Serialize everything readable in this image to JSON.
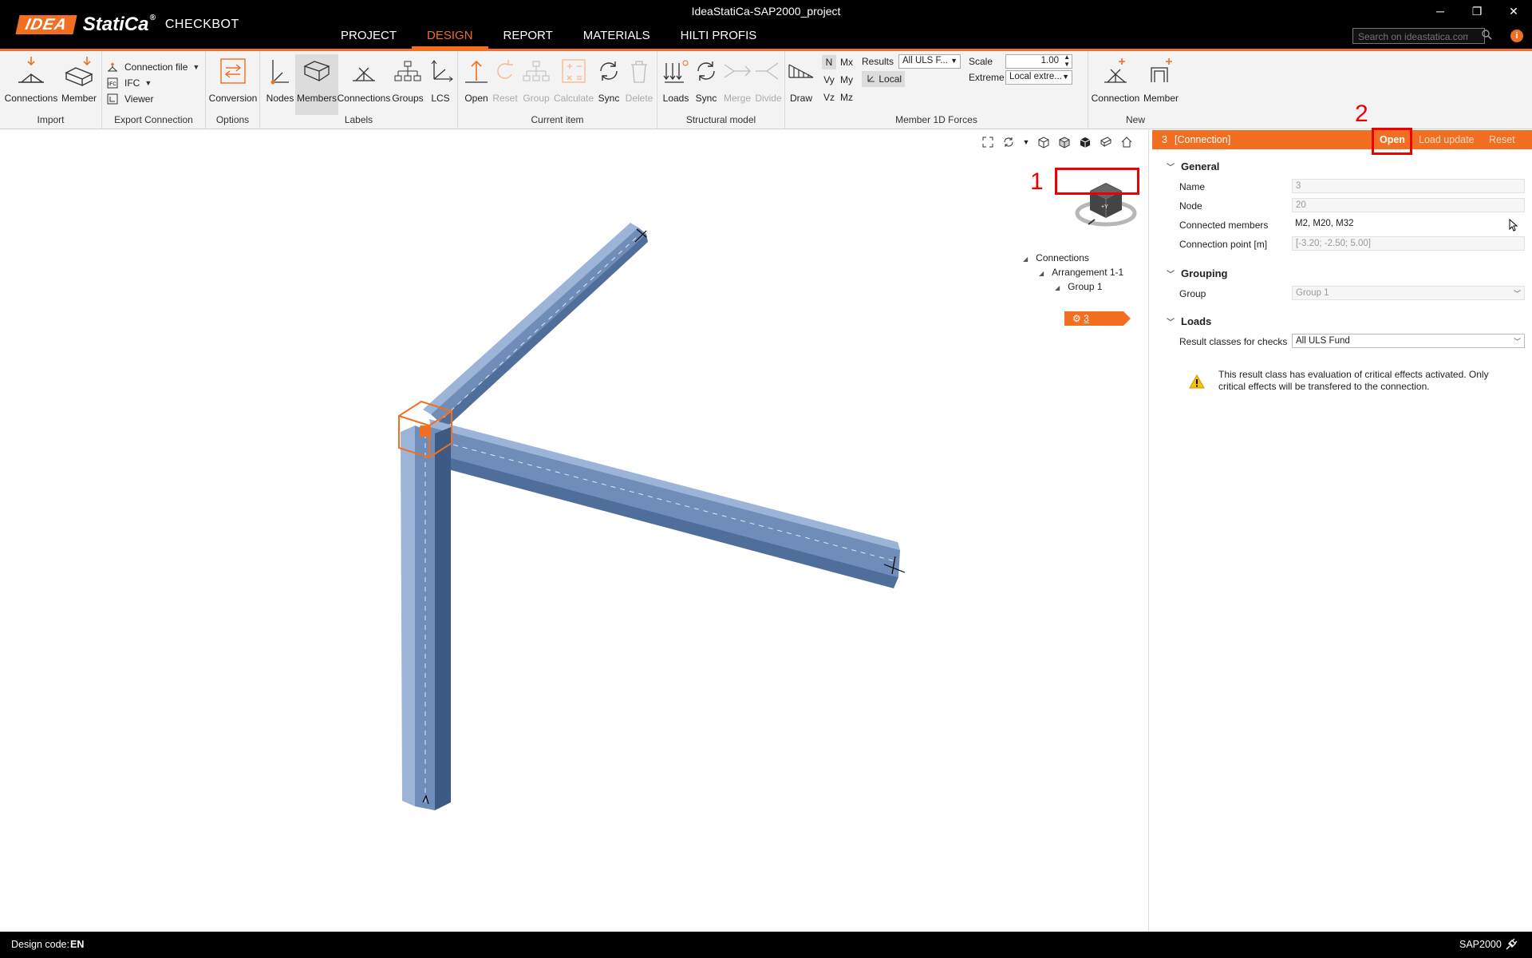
{
  "window": {
    "title": "IdeaStatiCa-SAP2000_project",
    "logo_idea": "IDEA",
    "logo_statica": "StatiCa",
    "logo_registered": "®",
    "product": "CHECKBOT",
    "minimize": "─",
    "restore": "❐",
    "close": "✕"
  },
  "menu": {
    "tabs": [
      "PROJECT",
      "DESIGN",
      "REPORT",
      "MATERIALS",
      "HILTI PROFIS"
    ],
    "active": "DESIGN"
  },
  "search": {
    "placeholder": "Search on ideastatica.com"
  },
  "ribbon": {
    "import": {
      "label": "Import",
      "connections": "Connections",
      "member": "Member"
    },
    "export": {
      "label": "Export Connection",
      "connection_file": "Connection file",
      "ifc": "IFC",
      "viewer": "Viewer"
    },
    "options": {
      "label": "Options",
      "conversion": "Conversion"
    },
    "labels": {
      "label": "Labels",
      "nodes": "Nodes",
      "members": "Members",
      "connections": "Connections",
      "groups": "Groups",
      "lcs": "LCS"
    },
    "current_item": {
      "label": "Current item",
      "open": "Open",
      "reset": "Reset",
      "group": "Group",
      "calculate": "Calculate",
      "sync": "Sync",
      "delete": "Delete"
    },
    "structural_model": {
      "label": "Structural model",
      "loads": "Loads",
      "sync": "Sync",
      "merge": "Merge",
      "divide": "Divide"
    },
    "forces": {
      "label": "Member 1D Forces",
      "draw": "Draw",
      "n": "N",
      "mx": "Mx",
      "vy": "Vy",
      "my": "My",
      "vz": "Vz",
      "mz": "Mz",
      "results_label": "Results",
      "results_value": "All ULS F...",
      "local": "Local",
      "scale_label": "Scale",
      "scale_value": "1.00",
      "extreme_label": "Extreme",
      "extreme_value": "Local extre..."
    },
    "new": {
      "label": "New",
      "connection": "Connection",
      "member": "Member"
    }
  },
  "tree": {
    "root": "Connections",
    "arrangement": "Arrangement 1-1",
    "group": "Group 1",
    "connection": "3"
  },
  "annotations": {
    "one": "1",
    "two": "2"
  },
  "panel": {
    "id": "3",
    "type": "[Connection]",
    "open": "Open",
    "load_update": "Load update",
    "reset": "Reset",
    "general": {
      "title": "General",
      "name_label": "Name",
      "name_value": "3",
      "node_label": "Node",
      "node_value": "20",
      "members_label": "Connected members",
      "members_value": "M2, M20, M32",
      "point_label": "Connection point [m]",
      "point_value": "[-3.20; -2.50; 5.00]"
    },
    "grouping": {
      "title": "Grouping",
      "group_label": "Group",
      "group_value": "Group 1"
    },
    "loads": {
      "title": "Loads",
      "result_label": "Result classes for checks",
      "result_value": "All ULS Fund",
      "warning": "This result class has evaluation of critical effects activated. Only critical effects will be transfered to the connection."
    }
  },
  "status": {
    "design_code_label": "Design code:",
    "design_code_value": "EN",
    "app": "SAP2000"
  },
  "colors": {
    "accent": "#f26f21",
    "steel": "#7f9cc6",
    "highlight": "#e00000"
  }
}
